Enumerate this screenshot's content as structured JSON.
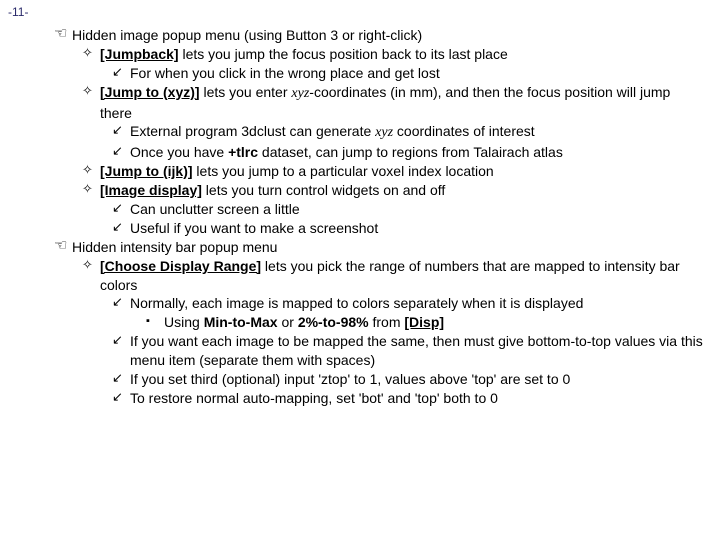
{
  "page_number": "-11-",
  "sections": [
    {
      "title": "Hidden image popup menu (using Button 3 or right-click)",
      "items": [
        {
          "link": "[Jumpback]",
          "desc": " lets you jump the focus position back to its last place",
          "sub": [
            {
              "text": "For when you click in the wrong place and get lost"
            }
          ]
        },
        {
          "link": "[Jump to (xyz)]",
          "desc_pre": " lets you enter ",
          "desc_ital": "xyz",
          "desc_post": "-coordinates (in mm), and then the focus position will jump there",
          "sub": [
            {
              "pre": "External program 3dclust can generate ",
              "ital": "xyz",
              "post": " coordinates of interest"
            },
            {
              "pre": "Once you have ",
              "bold": "+tlrc",
              "post": " dataset, can jump to regions from Talairach atlas"
            }
          ]
        },
        {
          "link": "[Jump to (ijk)]",
          "desc": " lets you jump to a particular voxel index location"
        },
        {
          "link": "[Image display]",
          "desc": " lets you turn control widgets on and off",
          "sub": [
            {
              "text": "Can unclutter screen a little"
            },
            {
              "text": "Useful if you want to make a screenshot"
            }
          ]
        }
      ]
    },
    {
      "title": "Hidden intensity bar popup menu",
      "items": [
        {
          "link": "[Choose Display Range]",
          "desc": " lets you pick the range of numbers that are mapped to intensity bar colors",
          "sub": [
            {
              "text": "Normally, each image is mapped to colors separately when it is displayed",
              "sub4": [
                {
                  "pre": "Using ",
                  "bold1": "Min-to-Max",
                  "mid": " or ",
                  "bold2": "2%-to-98%",
                  "mid2": " from ",
                  "link": "[Disp]"
                }
              ]
            },
            {
              "text": "If you want each image to be mapped the same, then must give bottom-to-top values via this menu item (separate them with spaces)"
            },
            {
              "text": "If you set third (optional) input 'ztop' to 1, values above 'top' are set to 0"
            },
            {
              "text": "To restore normal auto-mapping, set 'bot' and 'top' both to 0"
            }
          ]
        }
      ]
    }
  ]
}
